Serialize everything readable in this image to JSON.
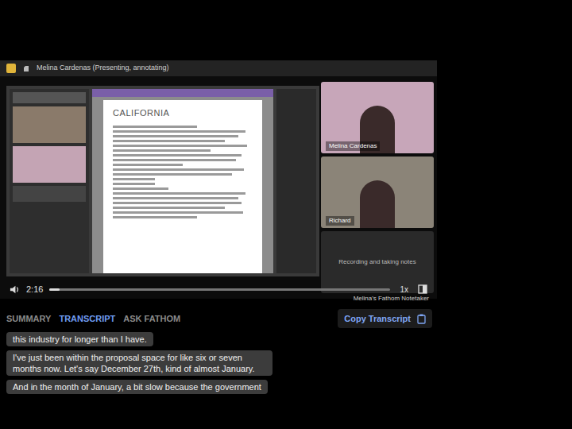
{
  "meeting_bar": {
    "label": "Melina Cardenas (Presenting, annotating)"
  },
  "shared_screen": {
    "doc_title": "CALIFORNIA"
  },
  "participants": [
    {
      "name": "Melina Cardenas"
    },
    {
      "name": "Richard"
    }
  ],
  "notetaker": {
    "status": "Recording and taking notes",
    "name": "Melina's Fathom Notetaker"
  },
  "player": {
    "time": "2:16",
    "level": 0.03,
    "speed": "1x"
  },
  "tabs": [
    {
      "label": "SUMMARY",
      "selected": false
    },
    {
      "label": "TRANSCRIPT",
      "selected": true
    },
    {
      "label": "ASK FATHOM",
      "selected": false
    }
  ],
  "copy_button": {
    "label": "Copy Transcript"
  },
  "transcript": [
    {
      "text": "this industry for longer than I have."
    },
    {
      "text": "I've just been within the proposal space for like six or seven months now. Let's say December 27th, kind of almost January."
    },
    {
      "text": "And in the month of January, a bit slow because the government"
    }
  ]
}
